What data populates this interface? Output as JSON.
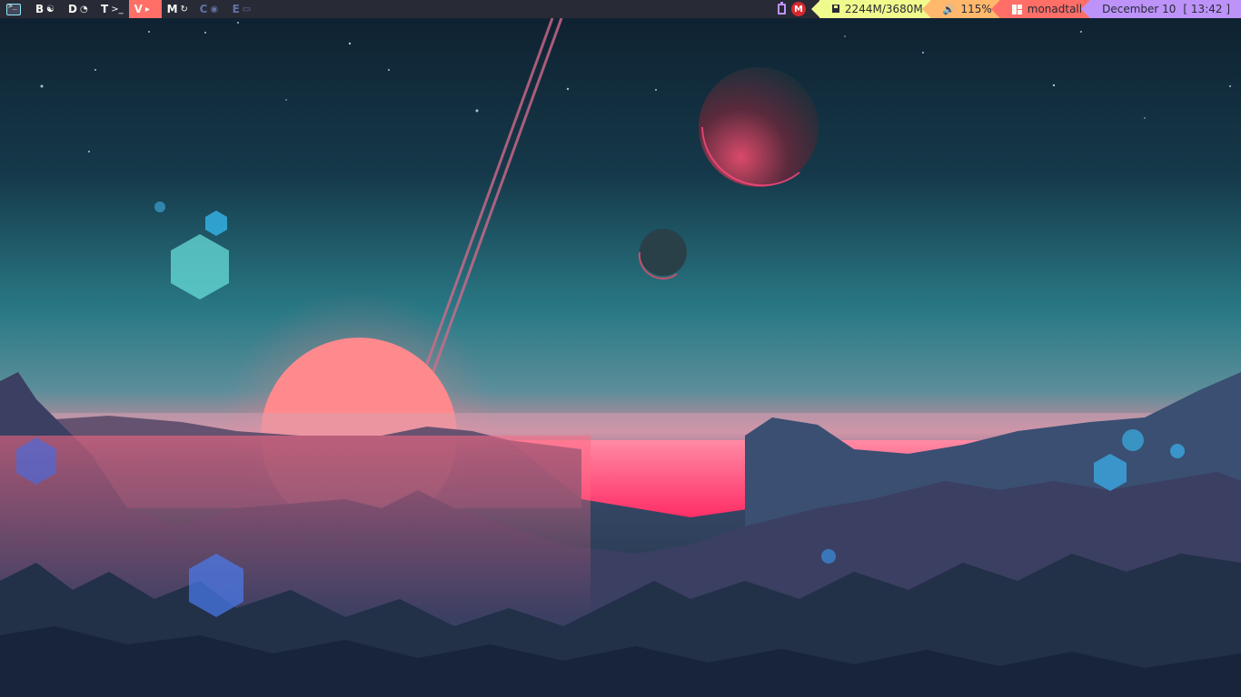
{
  "bar": {
    "groups": [
      {
        "label": "B",
        "icon": "☯",
        "state": "normal"
      },
      {
        "label": "D",
        "icon": "◔",
        "state": "normal"
      },
      {
        "label": "T",
        "icon": ">_",
        "state": "normal"
      },
      {
        "label": "V",
        "icon": "▸",
        "state": "active"
      },
      {
        "label": "M",
        "icon": "↻",
        "state": "normal"
      },
      {
        "label": "C",
        "icon": "◉",
        "state": "empty"
      },
      {
        "label": "E",
        "icon": "▭",
        "state": "empty"
      }
    ],
    "memory": "2244M/3680M",
    "volume_icon": "🔊",
    "volume": "115%",
    "layout": "monadtall",
    "date": "December 10",
    "time": "[ 13:42 ]",
    "mega_label": "M",
    "colors": {
      "bar_bg": "#282a36",
      "active_group": "#ff6e67",
      "memory": "#f1fa8c",
      "volume": "#ffb86c",
      "layout": "#ff6e67",
      "clock": "#bd93f9"
    }
  },
  "wallpaper": {
    "subject": "pink sunset over forested valley with planets and starry sky"
  }
}
